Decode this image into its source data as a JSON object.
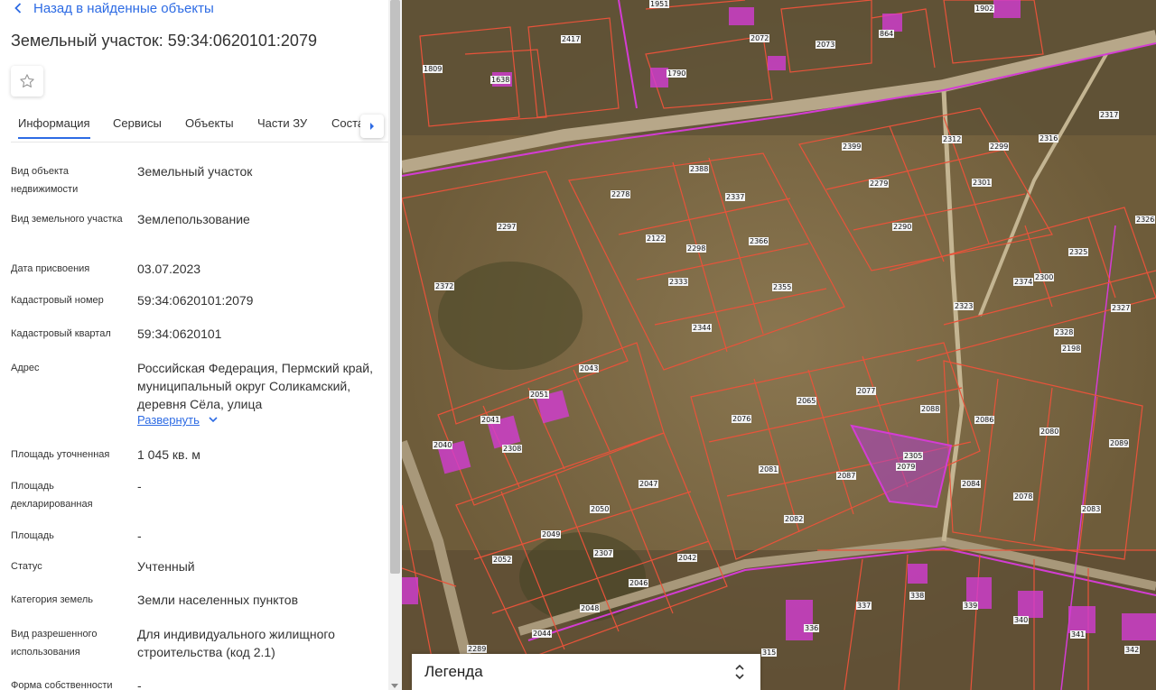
{
  "header": {
    "back_label": "Назад в найденные объекты",
    "title": "Земельный участок: 59:34:0620101:2079"
  },
  "tabs": [
    {
      "label": "Информация",
      "active": true
    },
    {
      "label": "Сервисы"
    },
    {
      "label": "Объекты"
    },
    {
      "label": "Части ЗУ"
    },
    {
      "label": "Соста"
    }
  ],
  "fields": [
    {
      "label": "Вид объекта недвижимости",
      "value": "Земельный участок"
    },
    {
      "label": "Вид земельного участка",
      "value": "Землепользование"
    },
    {
      "label": "Дата присвоения",
      "value": "03.07.2023"
    },
    {
      "label": "Кадастровый номер",
      "value": "59:34:0620101:2079"
    },
    {
      "label": "Кадастровый квартал",
      "value": "59:34:0620101"
    },
    {
      "label": "Адрес",
      "value": "Российская Федерация, Пермский край, муниципальный округ Соликамский, деревня Сёла, улица"
    },
    {
      "label": "Площадь уточненная",
      "value": "1 045 кв. м"
    },
    {
      "label": "Площадь декларированная",
      "value": "-"
    },
    {
      "label": "Площадь",
      "value": "-"
    },
    {
      "label": "Статус",
      "value": "Учтенный"
    },
    {
      "label": "Категория земель",
      "value": "Земли населенных пунктов"
    },
    {
      "label": "Вид разрешенного использования",
      "value": "Для индивидуального жилищного строительства (код 2.1)"
    },
    {
      "label": "Форма собственности",
      "value": "-"
    }
  ],
  "expand_label": "Развернуть",
  "legend": {
    "title": "Легенда"
  },
  "map": {
    "plot_labels": [
      "1951",
      "1902",
      "2417",
      "2072",
      "2073",
      "864",
      "1809",
      "1638",
      "1790",
      "2317",
      "2312",
      "2299",
      "2316",
      "2399",
      "2388",
      "2278",
      "2337",
      "2279",
      "2301",
      "2297",
      "2122",
      "2298",
      "2366",
      "2290",
      "2326",
      "2325",
      "2300",
      "2374",
      "2372",
      "2333",
      "2355",
      "2323",
      "2327",
      "2344",
      "2328",
      "2198",
      "2043",
      "2051",
      "2077",
      "2065",
      "2088",
      "2076",
      "2086",
      "2041",
      "2080",
      "2040",
      "2308",
      "2305",
      "2079",
      "2089",
      "2081",
      "2087",
      "2047",
      "2084",
      "2078",
      "2050",
      "2082",
      "2083",
      "2049",
      "2307",
      "2052",
      "2042",
      "2046",
      "2048",
      "2044",
      "338",
      "339",
      "340",
      "336",
      "337",
      "341",
      "342",
      "315",
      "2289"
    ],
    "colors": {
      "parcel_outline": "#e8533a",
      "building": "#d43cd4",
      "selected_fill": "#b040c8",
      "link": "#2d6be4"
    }
  }
}
